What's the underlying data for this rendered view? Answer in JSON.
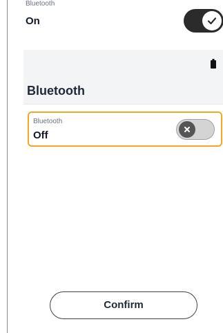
{
  "background_setting": {
    "caption": "Bluetooth",
    "value": "On",
    "toggle_state": "on"
  },
  "dialog": {
    "title": "Bluetooth",
    "status_icon": "battery-icon",
    "setting": {
      "caption": "Bluetooth",
      "value": "Off",
      "toggle_state": "off"
    },
    "confirm_label": "Confirm"
  },
  "colors": {
    "focus_outline": "#f5a623",
    "toggle_on": "#2b2b2b",
    "toggle_off": "#d4d4d4",
    "header_bg": "#f3f4f6"
  }
}
